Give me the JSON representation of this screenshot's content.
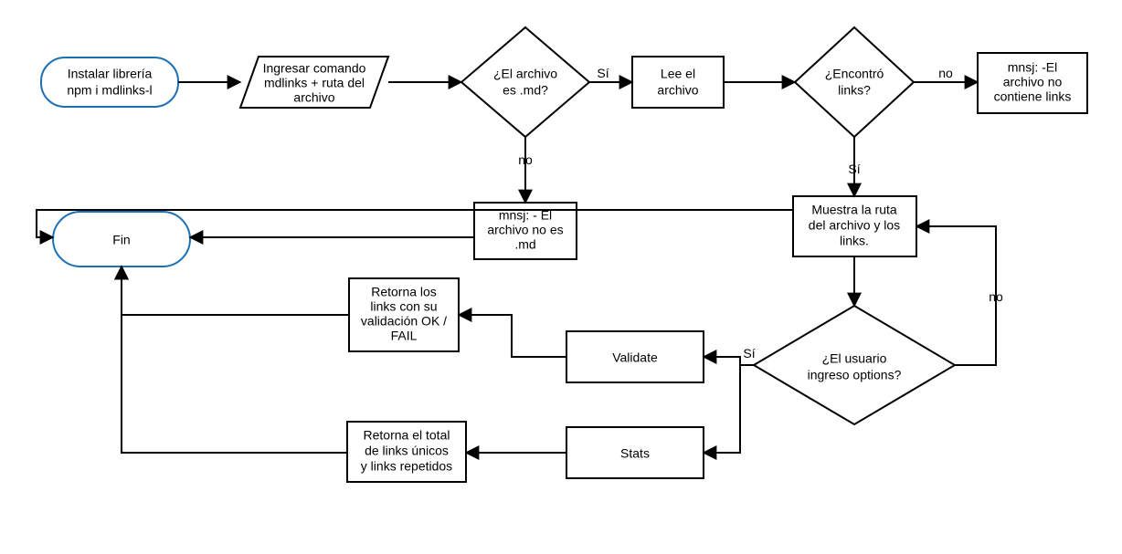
{
  "nodes": {
    "install": {
      "l1": "Instalar librería",
      "l2": "npm i  mdlinks-l"
    },
    "command": {
      "l1": "Ingresar comando",
      "l2": "mdlinks + ruta del",
      "l3": "archivo"
    },
    "isMd": {
      "l1": "¿El archivo",
      "l2": "es .md?"
    },
    "read": {
      "l1": "Lee el",
      "l2": "archivo"
    },
    "found": {
      "l1": "¿Encontró",
      "l2": "links?"
    },
    "noLinks": {
      "l1": "mnsj: -El",
      "l2": "archivo no",
      "l3": "contiene links"
    },
    "notMd": {
      "l1": "mnsj: - El",
      "l2": "archivo no es",
      "l3": ".md"
    },
    "show": {
      "l1": "Muestra la ruta",
      "l2": "del archivo y los",
      "l3": "links."
    },
    "options": {
      "l1": "¿El usuario",
      "l2": "ingreso options?"
    },
    "validate": {
      "l1": "Validate"
    },
    "stats": {
      "l1": "Stats"
    },
    "retVal": {
      "l1": "Retorna los",
      "l2": "links con su",
      "l3": "validación OK /",
      "l4": "FAIL"
    },
    "retStats": {
      "l1": "Retorna el total",
      "l2": "de links únicos",
      "l3": "y links repetidos"
    },
    "fin": {
      "l1": "Fin"
    }
  },
  "edges": {
    "isMd_yes": "Sí",
    "isMd_no": "no",
    "found_yes": "Sí",
    "found_no": "no",
    "options_yes": "Sí",
    "options_no": "no"
  }
}
